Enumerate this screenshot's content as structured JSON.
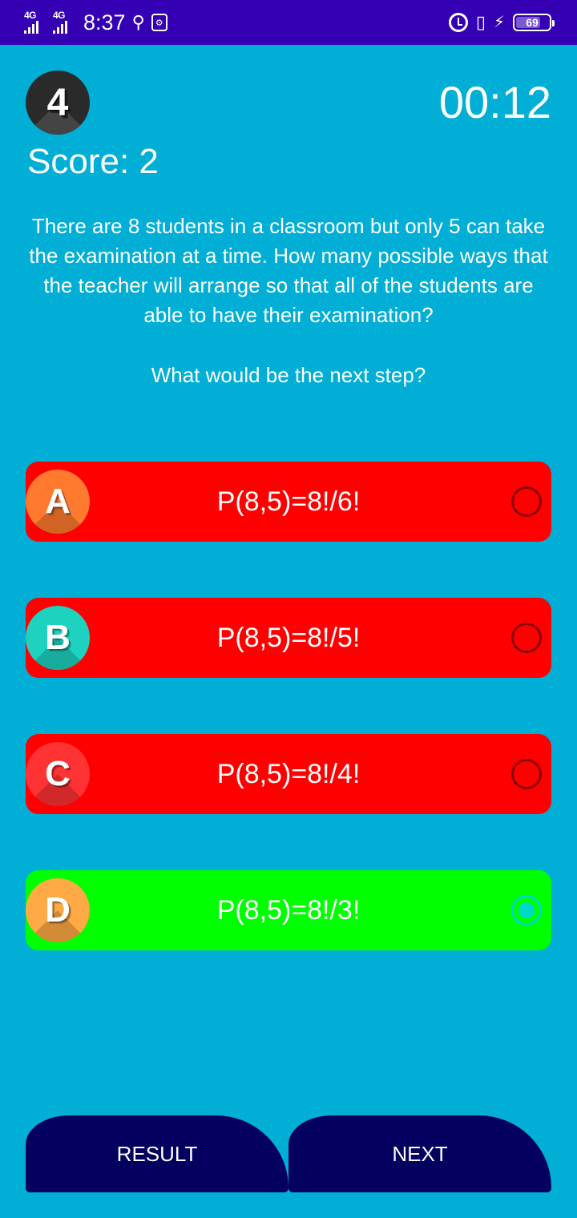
{
  "status_bar": {
    "network_1": "4G",
    "network_2": "4G",
    "time": "8:37",
    "usb_icon": "usb-icon",
    "battery_level": "69",
    "colors": {
      "background": "#3500B4"
    }
  },
  "header": {
    "question_number": "4",
    "timer": "00:12",
    "score": "Score: 2"
  },
  "question": {
    "text": "There are 8 students in a classroom but only 5 can take the examination at a time. How many possible ways that the teacher will arrange so that all of the students are able to have their examination?",
    "prompt": "What would be the next step?"
  },
  "options": [
    {
      "letter": "A",
      "text": "P(8,5)=8!/6!",
      "badge_color": "#FF7A2E",
      "selected": false
    },
    {
      "letter": "B",
      "text": "P(8,5)=8!/5!",
      "badge_color": "#1ED2C0",
      "selected": false
    },
    {
      "letter": "C",
      "text": "P(8,5)=8!/4!",
      "badge_color": "#FF3333",
      "selected": false
    },
    {
      "letter": "D",
      "text": "P(8,5)=8!/3!",
      "badge_color": "#FFAA44",
      "selected": true
    }
  ],
  "buttons": {
    "result": "RESULT",
    "next": "NEXT"
  },
  "colors": {
    "background": "#00AED6",
    "wrong": "#FF0000",
    "correct": "#00FF00",
    "button": "#03005F"
  }
}
